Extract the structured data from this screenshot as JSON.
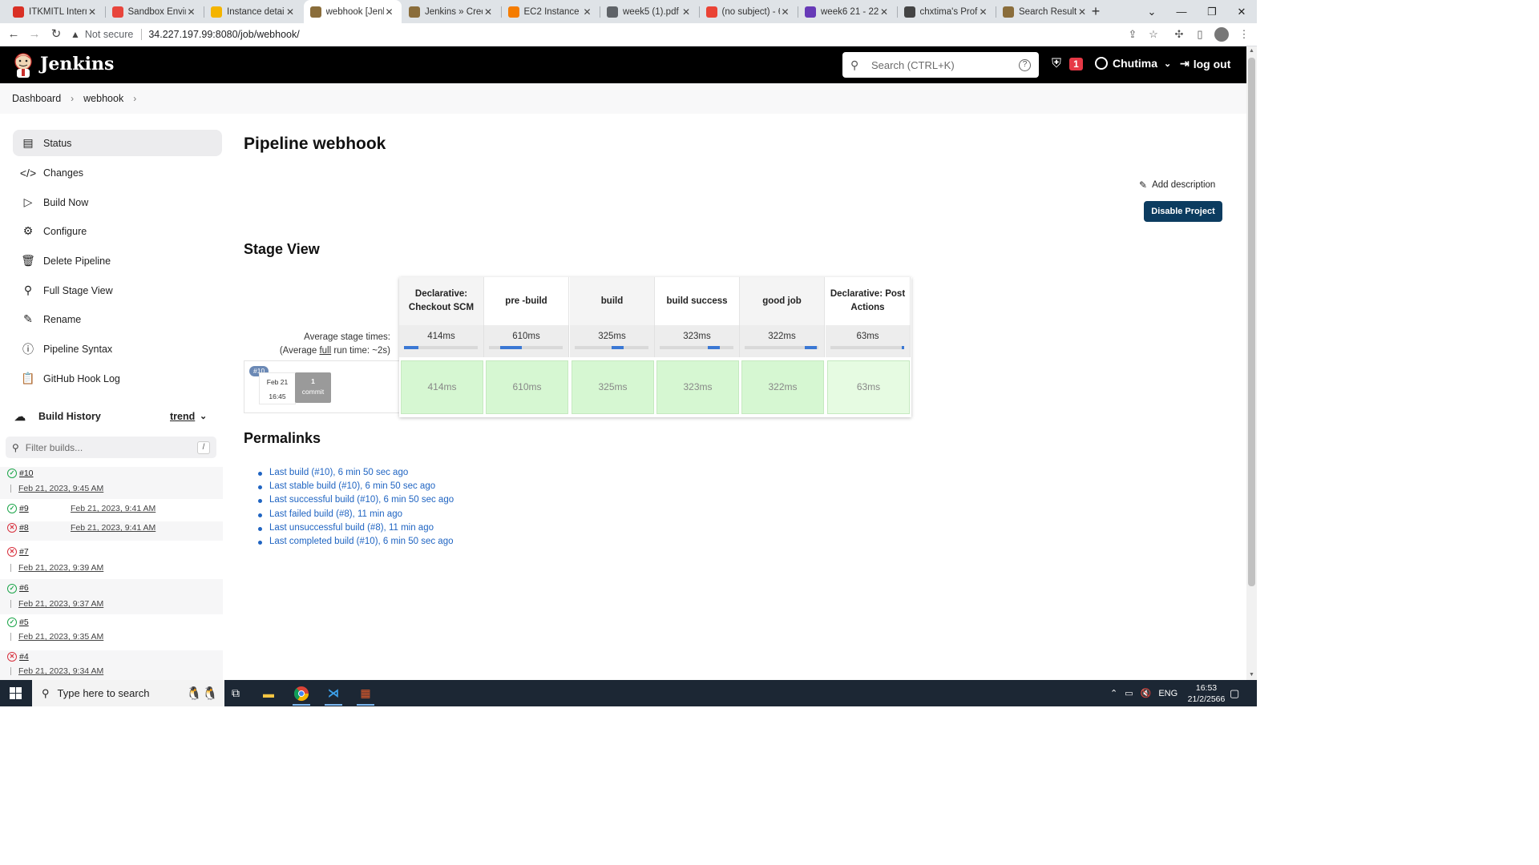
{
  "browser": {
    "tabs": [
      {
        "label": "ITKMITL Interne",
        "color": "#d93025"
      },
      {
        "label": "Sandbox Enviro",
        "color": "#e8453c"
      },
      {
        "label": "Instance details",
        "color": "#f4b400"
      },
      {
        "label": "webhook [Jenkin",
        "color": "#8a6d3b",
        "active": true
      },
      {
        "label": "Jenkins » Crede",
        "color": "#8a6d3b"
      },
      {
        "label": "EC2 Instance Co",
        "color": "#f57c00"
      },
      {
        "label": "week5 (1).pdf",
        "color": "#5f6368"
      },
      {
        "label": "(no subject) - 6",
        "color": "#ea4335"
      },
      {
        "label": "week6 21 - 22 F",
        "color": "#673ab7"
      },
      {
        "label": "chxtima's Profile",
        "color": "#444444"
      },
      {
        "label": "Search Results |",
        "color": "#8a6d3b"
      }
    ],
    "security_label": "Not secure",
    "url": "34.227.197.99:8080/job/webhook/"
  },
  "header": {
    "brand": "Jenkins",
    "search_placeholder": "Search (CTRL+K)",
    "security_count": "1",
    "user": "Chutima",
    "logout": "log out"
  },
  "breadcrumb": {
    "items": [
      "Dashboard",
      "webhook"
    ]
  },
  "sidebar": {
    "items": [
      {
        "label": "Status",
        "icon": "status-icon"
      },
      {
        "label": "Changes",
        "icon": "code-icon"
      },
      {
        "label": "Build Now",
        "icon": "play-icon"
      },
      {
        "label": "Configure",
        "icon": "gear-icon"
      },
      {
        "label": "Delete Pipeline",
        "icon": "trash-icon"
      },
      {
        "label": "Full Stage View",
        "icon": "search-icon"
      },
      {
        "label": "Rename",
        "icon": "pencil-icon"
      },
      {
        "label": "Pipeline Syntax",
        "icon": "help-icon"
      },
      {
        "label": "GitHub Hook Log",
        "icon": "clipboard-icon"
      }
    ]
  },
  "build_history": {
    "title": "Build History",
    "trend": "trend",
    "filter_placeholder": "Filter builds...",
    "filter_shortcut": "/",
    "builds": [
      {
        "num": "#10",
        "date": "Feb 21, 2023, 9:45 AM",
        "status": "success"
      },
      {
        "num": "#9",
        "date": "Feb 21, 2023, 9:41 AM",
        "status": "success"
      },
      {
        "num": "#8",
        "date": "Feb 21, 2023, 9:41 AM",
        "status": "failed"
      },
      {
        "num": "#7",
        "date": "Feb 21, 2023, 9:39 AM",
        "status": "failed"
      },
      {
        "num": "#6",
        "date": "Feb 21, 2023, 9:37 AM",
        "status": "success"
      },
      {
        "num": "#5",
        "date": "Feb 21, 2023, 9:35 AM",
        "status": "success"
      },
      {
        "num": "#4",
        "date": "Feb 21, 2023, 9:34 AM",
        "status": "failed"
      }
    ]
  },
  "main": {
    "title": "Pipeline webhook",
    "add_description": "Add description",
    "disable_project": "Disable Project",
    "stage_view_title": "Stage View",
    "avg_stage_times": "Average stage times:",
    "avg_run_time_prefix": "(Average ",
    "avg_run_time_link": "full",
    "avg_run_time_suffix": " run time: ~2s)",
    "stages": [
      {
        "name": "Declarative: Checkout SCM",
        "avg": "414ms",
        "run": "414ms",
        "bar_start": 0.0,
        "bar_fill": 0.2
      },
      {
        "name": "pre -build",
        "avg": "610ms",
        "run": "610ms",
        "bar_start": 0.15,
        "bar_fill": 0.3
      },
      {
        "name": "build",
        "avg": "325ms",
        "run": "325ms",
        "bar_start": 0.5,
        "bar_fill": 0.16
      },
      {
        "name": "build success",
        "avg": "323ms",
        "run": "323ms",
        "bar_start": 0.65,
        "bar_fill": 0.16
      },
      {
        "name": "good job",
        "avg": "322ms",
        "run": "322ms",
        "bar_start": 0.82,
        "bar_fill": 0.16
      },
      {
        "name": "Declarative: Post Actions",
        "avg": "63ms",
        "run": "63ms",
        "bar_start": 0.97,
        "bar_fill": 0.03
      }
    ],
    "build": {
      "num": "#10",
      "date": "Feb 21",
      "time": "16:45",
      "commit_count": "1",
      "commit_label": "commit"
    },
    "permalinks_title": "Permalinks",
    "permalinks": [
      "Last build (#10), 6 min 50 sec ago",
      "Last stable build (#10), 6 min 50 sec ago",
      "Last successful build (#10), 6 min 50 sec ago",
      "Last failed build (#8), 11 min ago",
      "Last unsuccessful build (#8), 11 min ago",
      "Last completed build (#10), 6 min 50 sec ago"
    ]
  },
  "taskbar": {
    "search_placeholder": "Type here to search",
    "lang": "ENG",
    "time": "16:53",
    "date": "21/2/2566"
  }
}
